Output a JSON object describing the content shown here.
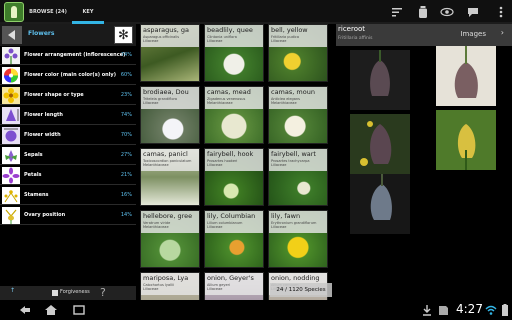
{
  "tabs": {
    "browse": "BROWSE (24)",
    "key": "KEY"
  },
  "toolbar_icons": [
    "sort-icon",
    "bottle-icon",
    "eye-icon",
    "chat-icon",
    "overflow-menu-icon"
  ],
  "left": {
    "title": "Flowers",
    "attributes": [
      {
        "label": "Flower arrangement (inflorescence)",
        "pct": "74%"
      },
      {
        "label": "Flower color (main color(s) only)",
        "pct": "60%"
      },
      {
        "label": "Flower shape or type",
        "pct": "23%"
      },
      {
        "label": "Flower length",
        "pct": "74%"
      },
      {
        "label": "Flower width",
        "pct": "70%"
      },
      {
        "label": "Sepals",
        "pct": "27%"
      },
      {
        "label": "Petals",
        "pct": "21%"
      },
      {
        "label": "Stamens",
        "pct": "16%"
      },
      {
        "label": "Ovary position",
        "pct": "14%"
      }
    ],
    "footer": {
      "arrow": "↑",
      "label": "Forgiveness",
      "help": "?"
    }
  },
  "cards": [
    {
      "common": "asparagus, ga",
      "sci": "Asparagus officinalis",
      "family": "Liliaceae"
    },
    {
      "common": "beadlily, quee",
      "sci": "Clintonia uniflora",
      "family": "Liliaceae"
    },
    {
      "common": "bell, yellow",
      "sci": "Fritillaria pudica",
      "family": "Liliaceae"
    },
    {
      "common": "brodiaea, Dou",
      "sci": "Triteleia grandiflora",
      "family": "Liliaceae"
    },
    {
      "common": "camas, mead",
      "sci": "Zigadenus venenosus",
      "family": "Melanthiaceae"
    },
    {
      "common": "camas, moun",
      "sci": "Anticlea elegans",
      "family": "Melanthiaceae"
    },
    {
      "common": "camas, panicl",
      "sci": "Toxicoscordion paniculatum",
      "family": "Melanthiaceae"
    },
    {
      "common": "fairybell, hook",
      "sci": "Prosartes hookeri",
      "family": "Liliaceae"
    },
    {
      "common": "fairybell, wart",
      "sci": "Prosartes trachycarpa",
      "family": "Liliaceae"
    },
    {
      "common": "hellebore, gree",
      "sci": "Veratrum viride",
      "family": "Melanthiaceae"
    },
    {
      "common": "lily, Columbian",
      "sci": "Lilium columbianum",
      "family": "Liliaceae"
    },
    {
      "common": "lily, fawn",
      "sci": "Erythronium grandiflorum",
      "family": "Liliaceae"
    },
    {
      "common": "mariposa, Lya",
      "sci": "Calochortus lyallii",
      "family": "Liliaceae"
    },
    {
      "common": "onion, Geyer's",
      "sci": "Allium geyeri",
      "family": "Liliaceae"
    },
    {
      "common": "onion, nodding",
      "sci": "Allium cernuum",
      "family": "Liliaceae"
    }
  ],
  "counter": "24 / 1120 Species",
  "right": {
    "title": "riceroot",
    "subtitle": "Fritillaria affinis",
    "images_label": "Images"
  },
  "status": {
    "clock": "4:27"
  },
  "colors": {
    "accent": "#33b5e5",
    "highlight": "#5ec0ee"
  }
}
